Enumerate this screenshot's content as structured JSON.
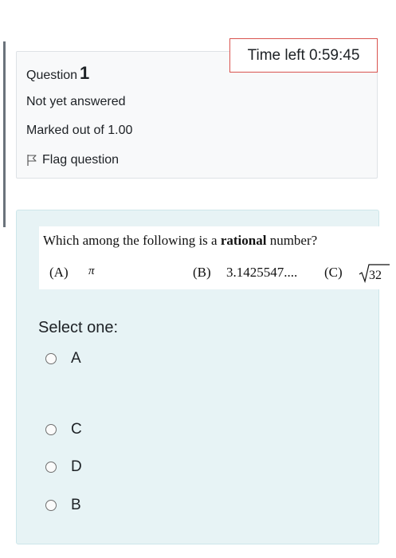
{
  "timer": {
    "label": "Time left",
    "value": "0:59:45"
  },
  "question_info": {
    "word": "Question",
    "number": "1",
    "state": "Not yet answered",
    "grade": "Marked out of 1.00",
    "flag_label": "Flag question"
  },
  "question_text": {
    "prefix": "Which among the following is a ",
    "bold": "rational",
    "suffix": " number?",
    "options": {
      "a_label": "(A)",
      "a_value": "π",
      "b_label": "(B)",
      "b_value": "3.1425547....",
      "c_label": "(C)",
      "c_value": "√32"
    }
  },
  "answer": {
    "prompt": "Select one:",
    "choices": [
      "A",
      "C",
      "D",
      "B"
    ]
  },
  "colors": {
    "timer_border": "#d9534f",
    "content_bg": "#e7f3f5",
    "info_bg": "#f8f9fa"
  }
}
